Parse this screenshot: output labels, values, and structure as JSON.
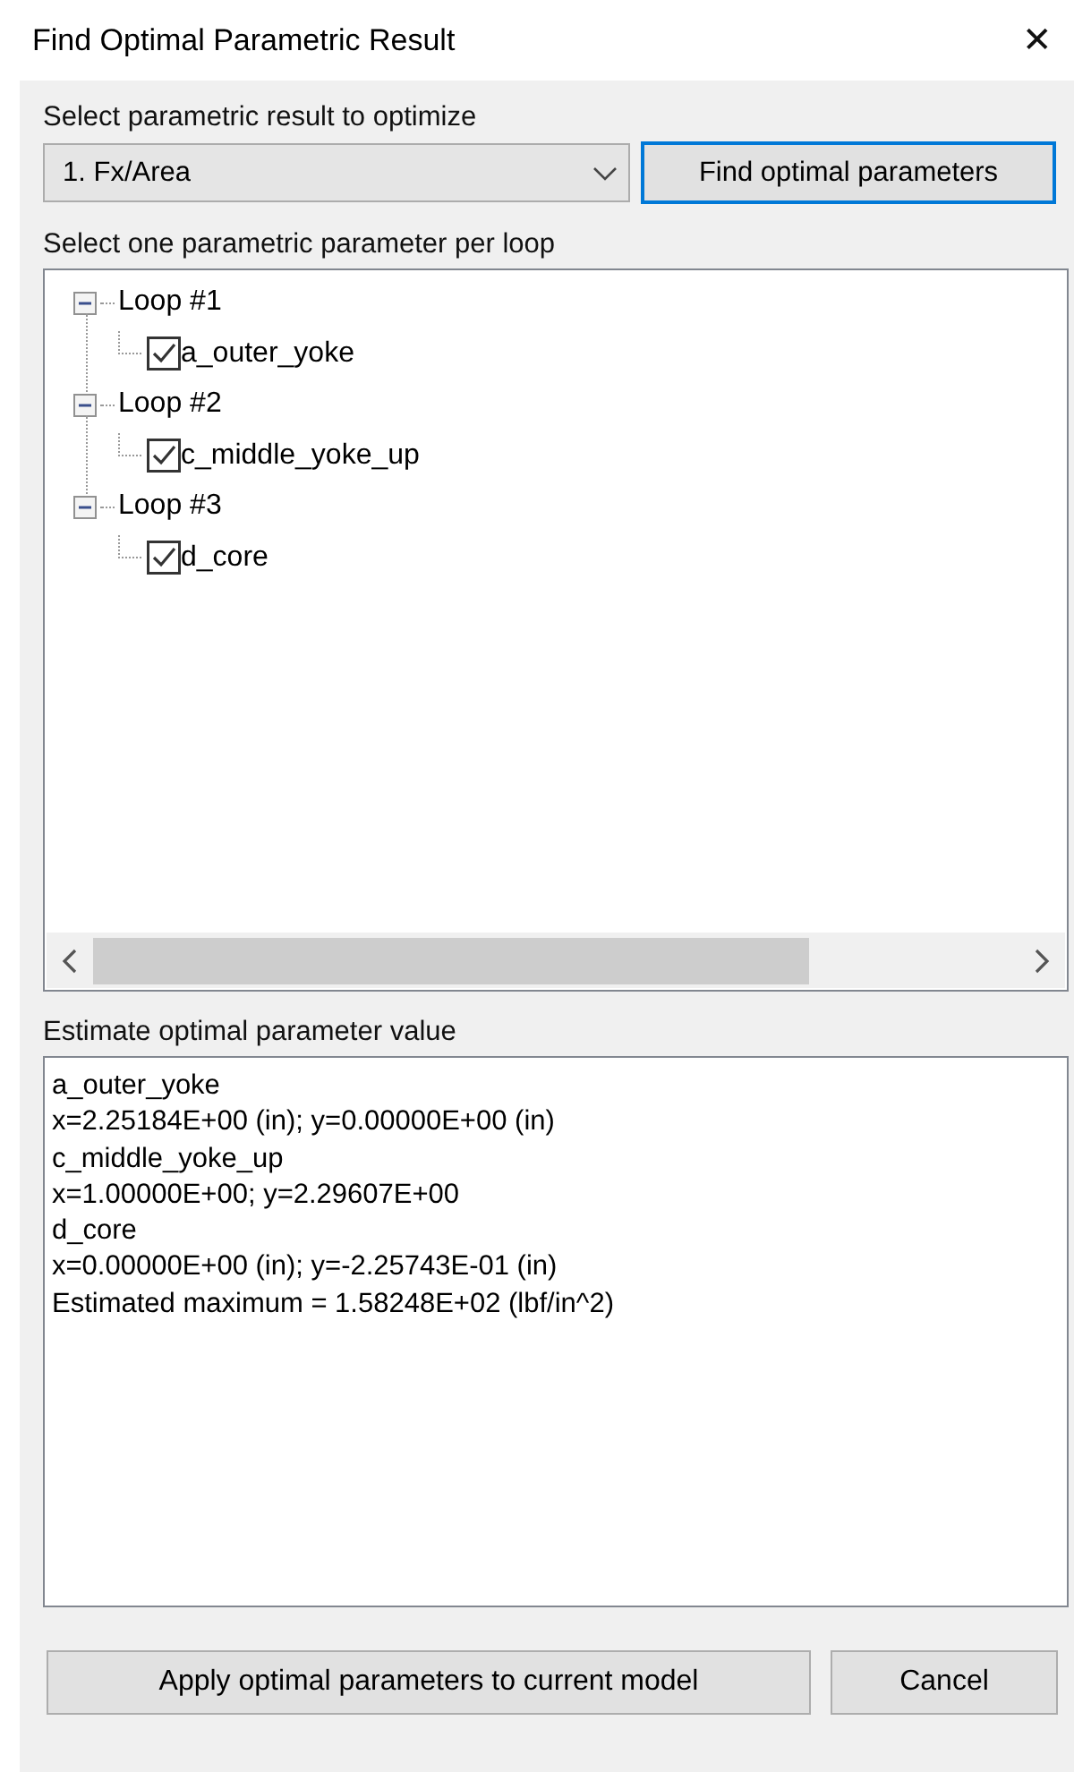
{
  "window": {
    "title": "Find Optimal Parametric Result",
    "close": "✕"
  },
  "result_select": {
    "label": "Select parametric result to optimize",
    "value": "1. Fx/Area"
  },
  "find_button": {
    "label": "Find optimal parameters",
    "focused": true
  },
  "tree": {
    "label": "Select one parametric parameter per loop",
    "nodes": [
      {
        "label": "Loop #1",
        "expanded": true,
        "children": [
          {
            "label": "a_outer_yoke",
            "checked": true
          }
        ]
      },
      {
        "label": "Loop #2",
        "expanded": true,
        "children": [
          {
            "label": "c_middle_yoke_up",
            "checked": true
          }
        ]
      },
      {
        "label": "Loop #3",
        "expanded": true,
        "children": [
          {
            "label": "d_core",
            "checked": true
          }
        ]
      }
    ]
  },
  "estimate": {
    "label": "Estimate optimal parameter value",
    "lines": [
      "a_outer_yoke",
      "x=2.25184E+00 (in); y=0.00000E+00 (in)",
      "c_middle_yoke_up",
      "x=1.00000E+00; y=2.29607E+00",
      "d_core",
      "x=0.00000E+00 (in); y=-2.25743E-01 (in)",
      "Estimated maximum = 1.58248E+02 (lbf/in^2)"
    ]
  },
  "buttons": [
    {
      "label": "Apply optimal parameters to current model",
      "kind": "apply"
    },
    {
      "label": "Cancel",
      "kind": "cancel"
    }
  ]
}
